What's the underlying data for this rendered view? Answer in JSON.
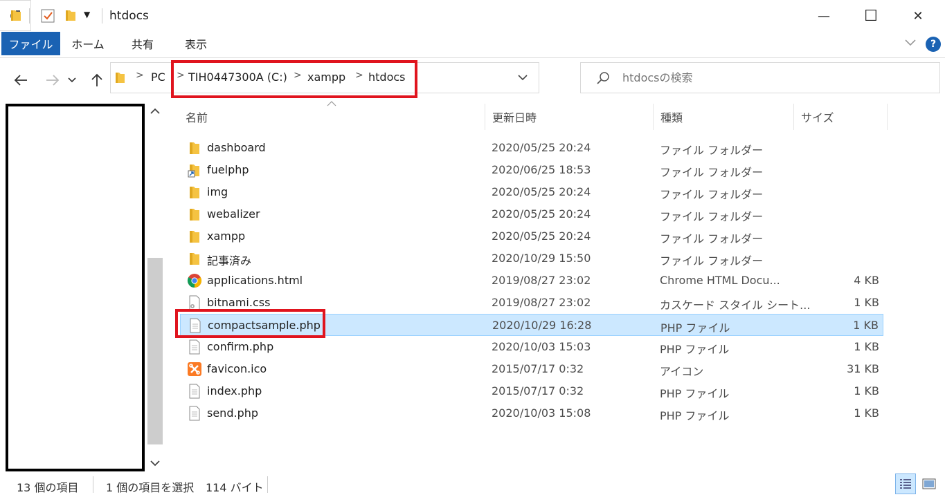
{
  "window": {
    "title": "htdocs",
    "minimize_glyph": "—",
    "maximize_glyph": "☐",
    "close_glyph": "✕"
  },
  "ribbon": {
    "tabs": [
      "ファイル",
      "ホーム",
      "共有",
      "表示"
    ],
    "help_glyph": "?"
  },
  "address": {
    "crumbs": [
      "PC",
      "TIH0447300A (C:)",
      "xampp",
      "htdocs"
    ]
  },
  "search": {
    "placeholder": "htdocsの検索"
  },
  "columns": {
    "name": "名前",
    "date": "更新日時",
    "type": "種類",
    "size": "サイズ"
  },
  "files": [
    {
      "name": "dashboard",
      "date": "2020/05/25 20:24",
      "type": "ファイル フォルダー",
      "size": "",
      "icon": "folder-icon"
    },
    {
      "name": "fuelphp",
      "date": "2020/06/25 18:53",
      "type": "ファイル フォルダー",
      "size": "",
      "icon": "shortcut-icon"
    },
    {
      "name": "img",
      "date": "2020/05/25 20:24",
      "type": "ファイル フォルダー",
      "size": "",
      "icon": "folder-icon"
    },
    {
      "name": "webalizer",
      "date": "2020/05/25 20:24",
      "type": "ファイル フォルダー",
      "size": "",
      "icon": "folder-icon"
    },
    {
      "name": "xampp",
      "date": "2020/05/25 20:24",
      "type": "ファイル フォルダー",
      "size": "",
      "icon": "folder-icon"
    },
    {
      "name": "記事済み",
      "date": "2020/10/29 15:50",
      "type": "ファイル フォルダー",
      "size": "",
      "icon": "folder-icon"
    },
    {
      "name": "applications.html",
      "date": "2019/08/27 23:02",
      "type": "Chrome HTML Docu...",
      "size": "4 KB",
      "icon": "chrome-icon"
    },
    {
      "name": "bitnami.css",
      "date": "2019/08/27 23:02",
      "type": "カスケード スタイル シート...",
      "size": "1 KB",
      "icon": "css-file-icon"
    },
    {
      "name": "compactsample.php",
      "date": "2020/10/29 16:28",
      "type": "PHP ファイル",
      "size": "1 KB",
      "icon": "file-icon",
      "selected": true
    },
    {
      "name": "confirm.php",
      "date": "2020/10/03 15:03",
      "type": "PHP ファイル",
      "size": "1 KB",
      "icon": "file-icon"
    },
    {
      "name": "favicon.ico",
      "date": "2015/07/17 0:32",
      "type": "アイコン",
      "size": "31 KB",
      "icon": "xampp-icon"
    },
    {
      "name": "index.php",
      "date": "2015/07/17 0:32",
      "type": "PHP ファイル",
      "size": "1 KB",
      "icon": "file-icon"
    },
    {
      "name": "send.php",
      "date": "2020/10/03 15:08",
      "type": "PHP ファイル",
      "size": "1 KB",
      "icon": "file-icon"
    }
  ],
  "status": {
    "count": "13 個の項目",
    "selection": "1 個の項目を選択",
    "bytes": "114 バイト"
  },
  "colors": {
    "accent": "#1a62b3",
    "selection_bg": "#cce8ff",
    "highlight": "#e0141e"
  }
}
